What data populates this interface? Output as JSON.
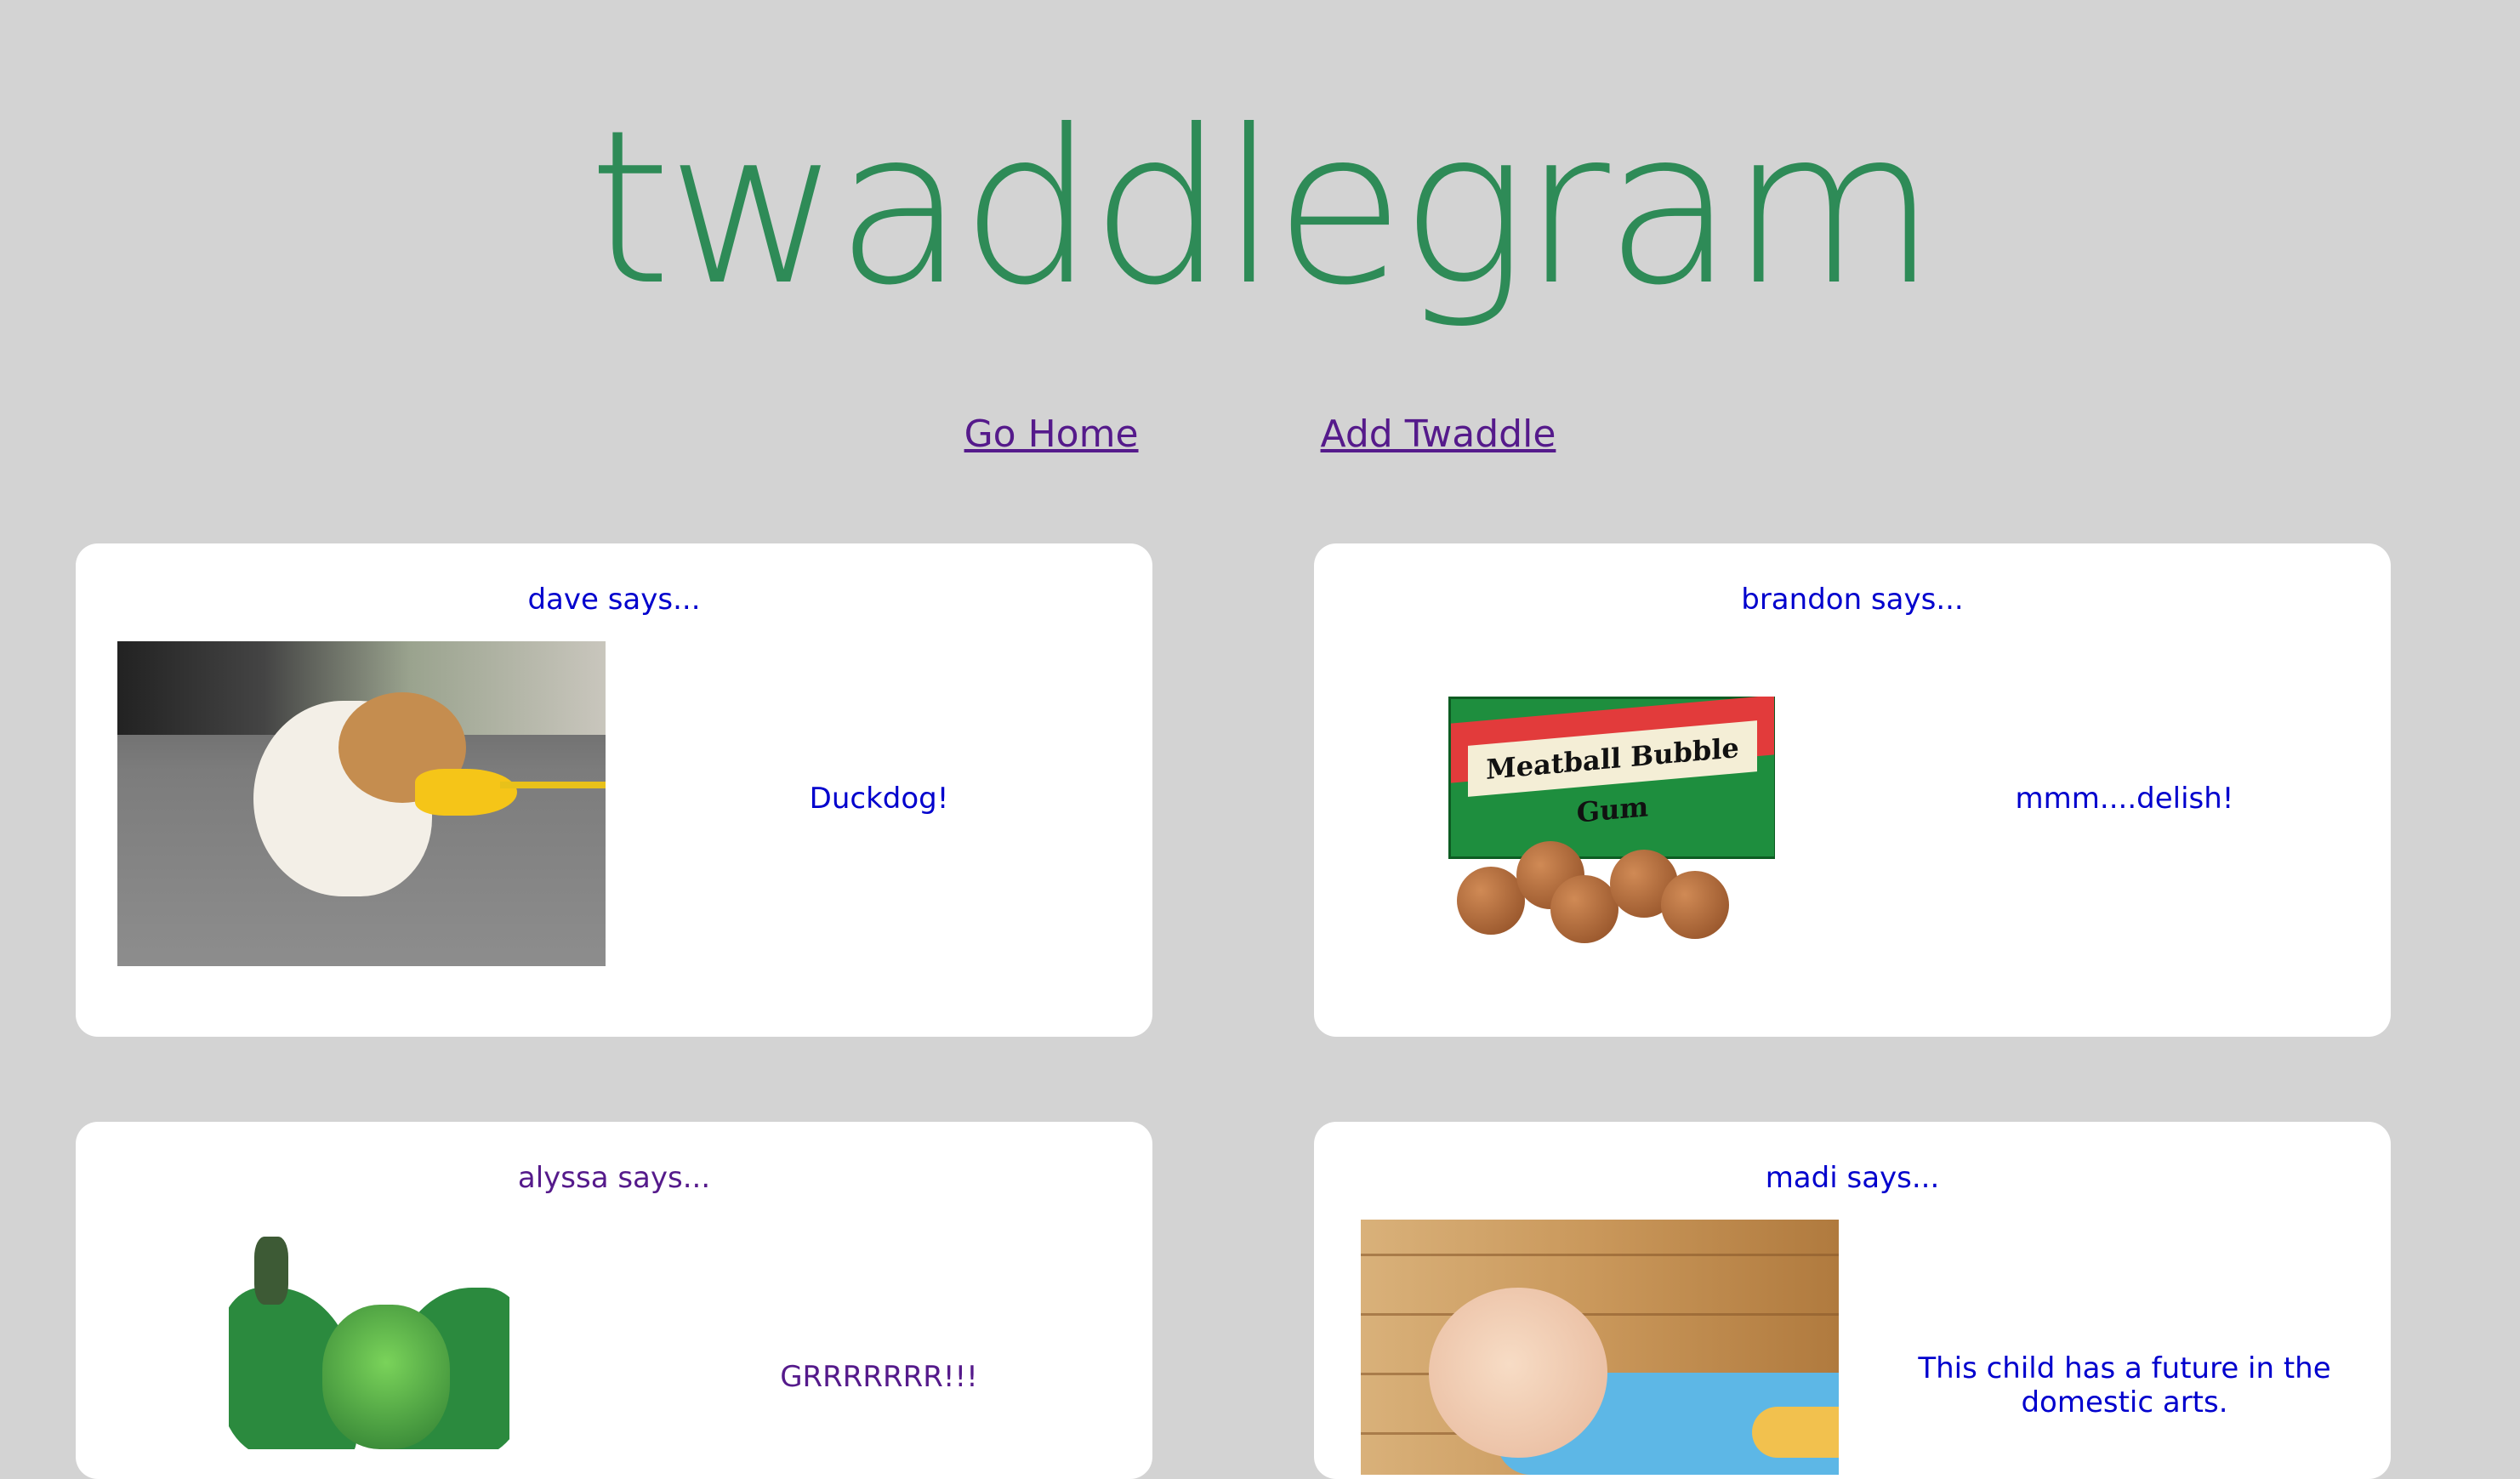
{
  "site": {
    "title": "twaddlegram"
  },
  "nav": {
    "home_label": "Go Home",
    "add_label": "Add Twaddle"
  },
  "posts": [
    {
      "author": "dave says...",
      "caption": "Duckdog!",
      "image": "dog-with-duck-bill-muzzle"
    },
    {
      "author": "brandon says...",
      "caption": "mmm....delish!",
      "image": "meatball-bubble-gum",
      "image_text": "Meatball Bubble Gum"
    },
    {
      "author": "alyssa says...",
      "caption": "GRRRRRRR!!!",
      "image": "cthulhu-figure"
    },
    {
      "author": "madi says...",
      "caption": "This child has a future in the domestic arts.",
      "image": "baby-in-mop-onesie"
    }
  ],
  "colors": {
    "background": "#d3d3d3",
    "title": "#2e8b57",
    "link_visited": "#551a8b",
    "text_blue": "#0000cd",
    "card": "#ffffff"
  }
}
